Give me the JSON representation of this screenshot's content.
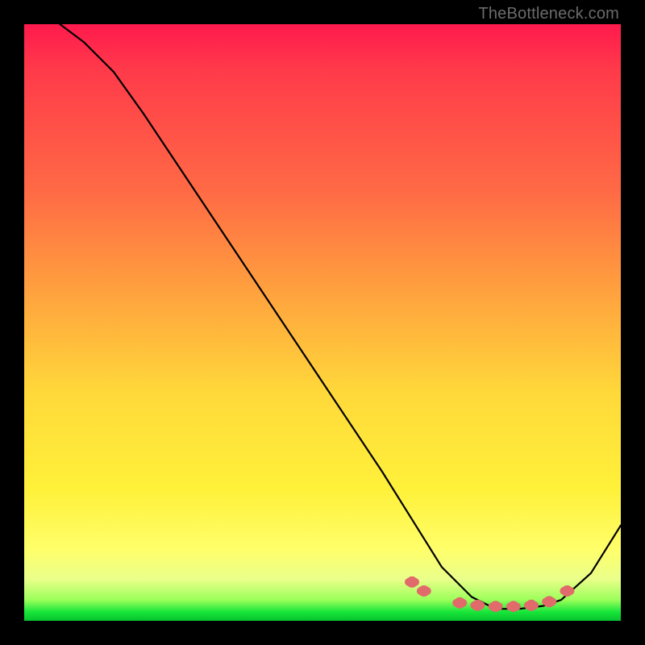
{
  "watermark": "TheBottleneck.com",
  "chart_data": {
    "type": "line",
    "title": "",
    "xlabel": "",
    "ylabel": "",
    "xlim": [
      0,
      100
    ],
    "ylim": [
      0,
      100
    ],
    "grid": false,
    "legend": false,
    "series": [
      {
        "name": "bottleneck-curve",
        "x": [
          6,
          10,
          15,
          20,
          30,
          40,
          50,
          60,
          65,
          70,
          75,
          78,
          80,
          83,
          87,
          90,
          95,
          100
        ],
        "y": [
          100,
          97,
          92,
          85,
          70,
          55,
          40,
          25,
          17,
          9,
          4,
          2.5,
          2,
          2,
          2.5,
          3.5,
          8,
          16
        ]
      }
    ],
    "markers": {
      "name": "highlight-dots",
      "color": "#e16a6a",
      "points": [
        {
          "x": 65,
          "y": 6.5
        },
        {
          "x": 67,
          "y": 5
        },
        {
          "x": 73,
          "y": 3
        },
        {
          "x": 76,
          "y": 2.6
        },
        {
          "x": 79,
          "y": 2.4
        },
        {
          "x": 82,
          "y": 2.4
        },
        {
          "x": 85,
          "y": 2.6
        },
        {
          "x": 88,
          "y": 3.2
        },
        {
          "x": 91,
          "y": 5
        }
      ]
    },
    "background_gradient": {
      "top": "#ff1a4d",
      "mid1": "#ffa23e",
      "mid2": "#fff13a",
      "bottom": "#07c22e"
    }
  }
}
